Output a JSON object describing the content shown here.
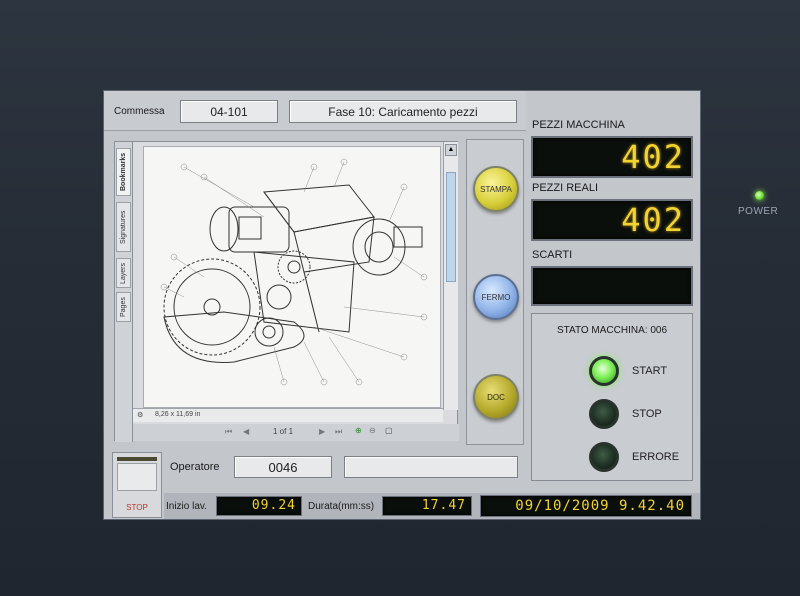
{
  "bezel": {
    "power_label": "POWER"
  },
  "header": {
    "commessa_label": "Commessa",
    "commessa_value": "04-101",
    "phase_value": "Fase 10: Caricamento pezzi"
  },
  "viewer": {
    "side_tabs": [
      "Bookmarks",
      "Signatures",
      "Layers",
      "Pages"
    ],
    "page_size": "8,26 x 11,69 in",
    "page_indicator": "1 of 1"
  },
  "buttons": {
    "stampa": "STAMPA",
    "fermo": "FERMO",
    "doc": "DOC"
  },
  "counters": {
    "pezzi_macchina_label": "PEZZI MACCHINA",
    "pezzi_macchina_value": "402",
    "pezzi_reali_label": "PEZZI REALI",
    "pezzi_reali_value": "402",
    "scarti_label": "SCARTI",
    "scarti_value": ""
  },
  "machine_status": {
    "title": "STATO MACCHINA: 006",
    "lamps": [
      {
        "label": "START",
        "state": "on"
      },
      {
        "label": "STOP",
        "state": "off"
      },
      {
        "label": "ERRORE",
        "state": "off"
      }
    ]
  },
  "operator": {
    "label": "Operatore",
    "value": "0046",
    "note": ""
  },
  "stop_widget": {
    "label": "STOP"
  },
  "footer": {
    "start_label": "Inizio lav.",
    "start_value": "09.24",
    "duration_label": "Durata(mm:ss)",
    "duration_value": "17.47",
    "datetime_value": "09/10/2009 9.42.40"
  },
  "colors": {
    "digit_color": "#f2d331",
    "lamp_on": "#7ff05a",
    "power_led": "#6fe03a"
  }
}
